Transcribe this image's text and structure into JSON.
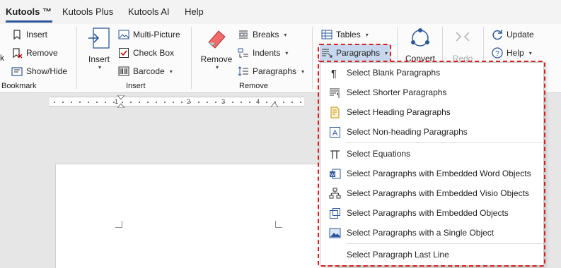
{
  "tabs": [
    "Kutools ™",
    "Kutools Plus",
    "Kutools AI",
    "Help"
  ],
  "bookmark_group": {
    "items": [
      "Insert",
      "Remove",
      "Show/Hide"
    ],
    "label": "Bookmark",
    "cut_label": "k"
  },
  "insert_group": {
    "insert_label": "Insert",
    "items": [
      "Multi-Picture",
      "Check Box",
      "Barcode"
    ],
    "label": "Insert"
  },
  "remove_group": {
    "remove_label": "Remove",
    "items": [
      "Breaks",
      "Indents",
      "Paragraphs"
    ],
    "label": "Remove"
  },
  "tables_label": "Tables",
  "paragraphs_label": "Paragraphs",
  "convert_label": "Convert",
  "redo_label": "Redo",
  "update_label": "Update",
  "help_label": "Help",
  "ruler": {
    "numbers": [
      "1",
      "2",
      "3",
      "4"
    ]
  },
  "menu": {
    "items": [
      {
        "label": "Select Blank Paragraphs",
        "icon": "pilcrow-icon"
      },
      {
        "label": "Select Shorter Paragraphs",
        "icon": "short-paragraph-icon"
      },
      {
        "label": "Select Heading Paragraphs",
        "icon": "heading-doc-icon"
      },
      {
        "label": "Select Non-heading Paragraphs",
        "icon": "text-frame-icon"
      },
      {
        "label": "Select Equations",
        "icon": "pi-icon"
      },
      {
        "label": "Select Paragraphs with Embedded Word Objects",
        "icon": "word-object-icon"
      },
      {
        "label": "Select Paragraphs with Embedded Visio Objects",
        "icon": "visio-object-icon"
      },
      {
        "label": "Select Paragraphs with Embedded Objects",
        "icon": "embedded-object-icon"
      },
      {
        "label": "Select Paragraphs with a Single Object",
        "icon": "picture-icon"
      },
      {
        "label": "Select Paragraph Last Line",
        "icon": ""
      }
    ]
  },
  "colors": {
    "accent": "#2b579a",
    "highlight_outline": "#d62020"
  }
}
